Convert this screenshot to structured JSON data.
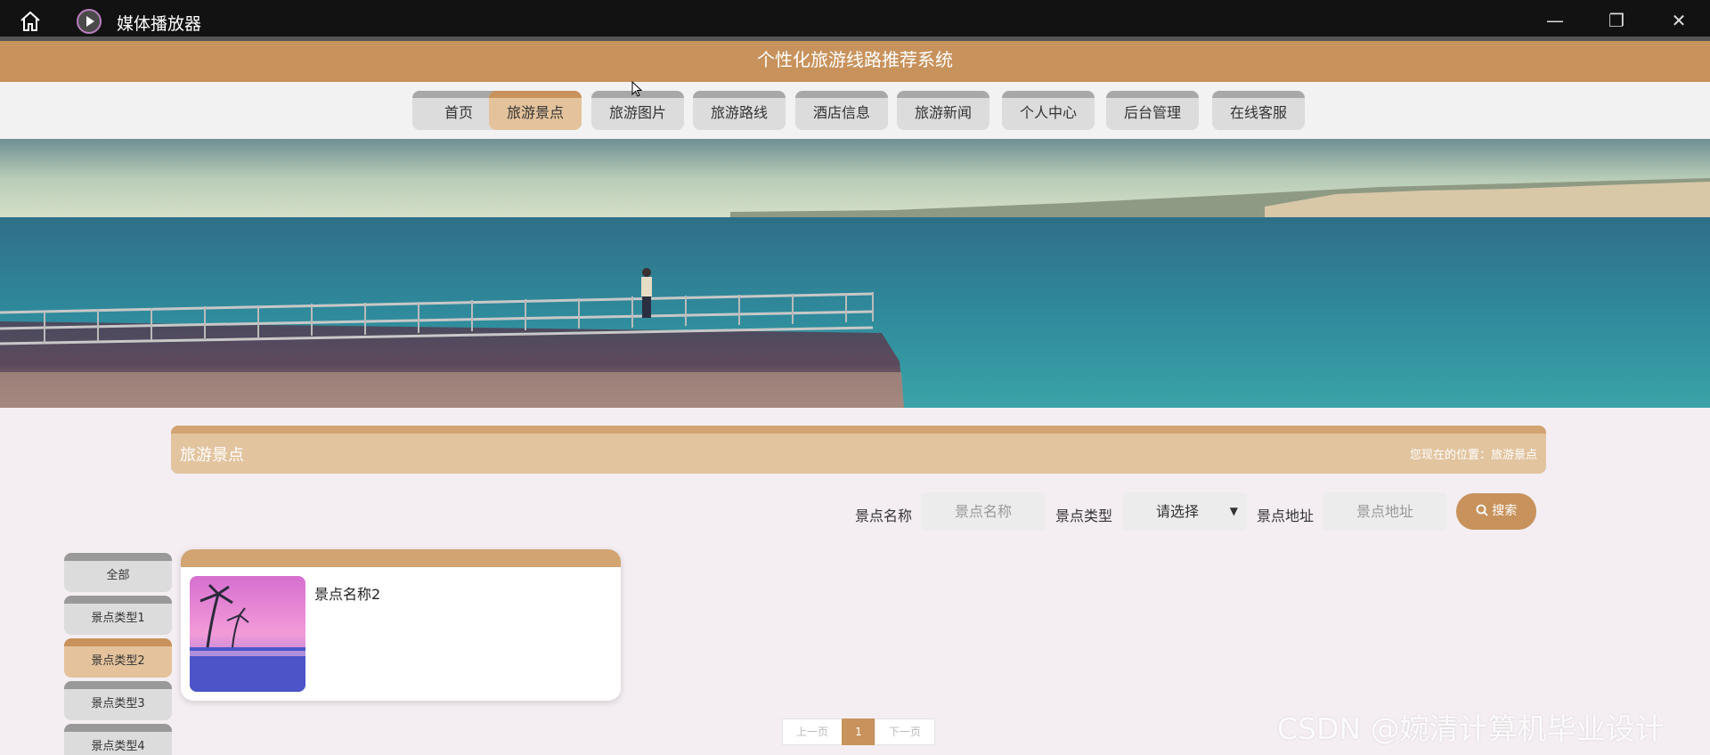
{
  "window": {
    "app_title": "媒体播放器",
    "min_symbol": "—",
    "max_symbol": "❐",
    "close_symbol": "✕",
    "home_icon": "home-icon",
    "app_icon": "play-icon"
  },
  "site": {
    "title": "个性化旅游线路推荐系统"
  },
  "nav": {
    "items": [
      {
        "label": "首页"
      },
      {
        "label": "旅游景点",
        "active": true
      },
      {
        "label": "旅游图片"
      },
      {
        "label": "旅游路线"
      },
      {
        "label": "酒店信息"
      },
      {
        "label": "旅游新闻"
      },
      {
        "label": "个人中心"
      },
      {
        "label": "后台管理"
      },
      {
        "label": "在线客服"
      }
    ]
  },
  "section": {
    "title": "旅游景点",
    "breadcrumb": "您现在的位置：旅游景点"
  },
  "search": {
    "name_label": "景点名称",
    "name_placeholder": "景点名称",
    "type_label": "景点类型",
    "type_selected": "请选择",
    "address_label": "景点地址",
    "address_placeholder": "景点地址",
    "button_label": "搜索",
    "button_icon": "search-icon"
  },
  "categories": [
    {
      "label": "全部"
    },
    {
      "label": "景点类型1"
    },
    {
      "label": "景点类型2",
      "active": true
    },
    {
      "label": "景点类型3"
    },
    {
      "label": "景点类型4"
    }
  ],
  "results": [
    {
      "name": "景点名称2"
    }
  ],
  "pagination": {
    "prev": "上一页",
    "current": "1",
    "next": "下一页"
  },
  "watermark": "CSDN @婉清计算机毕业设计",
  "colors": {
    "accent": "#c8925c",
    "accent_light": "#e4c39c",
    "titlebar": "#121212"
  }
}
